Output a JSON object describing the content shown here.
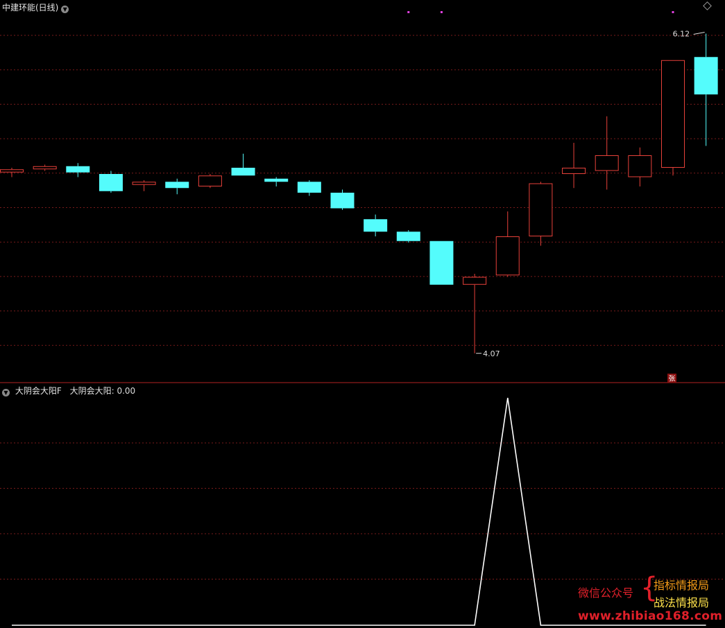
{
  "window": {
    "title": "中建环能(日线)",
    "header_icon": "chevron-down-icon",
    "menu_icon": "diamond-icon"
  },
  "colors": {
    "background": "#000000",
    "up": "#e8413a",
    "down": "#54fcfc",
    "grid": "#7a1b1b",
    "divider": "#b22222",
    "indicator_line": "#ffffff",
    "marker": "#e040e0"
  },
  "chart_data": [
    {
      "type": "candlestick",
      "title": "中建环能(日线)",
      "ylim": [
        3.98,
        6.22
      ],
      "grid": true,
      "high_label": "6.12",
      "low_label": "4.07",
      "badge": "张",
      "candles": [
        {
          "o": 5.23,
          "h": 5.26,
          "l": 5.2,
          "c": 5.25
        },
        {
          "o": 5.25,
          "h": 5.28,
          "l": 5.24,
          "c": 5.27
        },
        {
          "o": 5.27,
          "h": 5.29,
          "l": 5.2,
          "c": 5.23
        },
        {
          "o": 5.22,
          "h": 5.24,
          "l": 5.1,
          "c": 5.11
        },
        {
          "o": 5.15,
          "h": 5.18,
          "l": 5.11,
          "c": 5.17
        },
        {
          "o": 5.17,
          "h": 5.19,
          "l": 5.09,
          "c": 5.13
        },
        {
          "o": 5.14,
          "h": 5.22,
          "l": 5.13,
          "c": 5.21
        },
        {
          "o": 5.26,
          "h": 5.35,
          "l": 5.21,
          "c": 5.21
        },
        {
          "o": 5.19,
          "h": 5.2,
          "l": 5.14,
          "c": 5.17
        },
        {
          "o": 5.17,
          "h": 5.18,
          "l": 5.08,
          "c": 5.1
        },
        {
          "o": 5.1,
          "h": 5.12,
          "l": 4.99,
          "c": 5.0
        },
        {
          "o": 4.93,
          "h": 4.96,
          "l": 4.82,
          "c": 4.85
        },
        {
          "o": 4.85,
          "h": 4.86,
          "l": 4.78,
          "c": 4.79
        },
        {
          "o": 4.79,
          "h": 4.79,
          "l": 4.51,
          "c": 4.51
        },
        {
          "o": 4.51,
          "h": 4.58,
          "l": 4.07,
          "c": 4.56
        },
        {
          "o": 4.57,
          "h": 4.98,
          "l": 4.56,
          "c": 4.82
        },
        {
          "o": 4.82,
          "h": 5.17,
          "l": 4.76,
          "c": 5.16
        },
        {
          "o": 5.22,
          "h": 5.42,
          "l": 5.13,
          "c": 5.26
        },
        {
          "o": 5.24,
          "h": 5.59,
          "l": 5.12,
          "c": 5.34
        },
        {
          "o": 5.2,
          "h": 5.39,
          "l": 5.14,
          "c": 5.34
        },
        {
          "o": 5.26,
          "h": 5.95,
          "l": 5.21,
          "c": 5.95
        },
        {
          "o": 5.97,
          "h": 6.12,
          "l": 5.4,
          "c": 5.73
        }
      ],
      "markers": [
        12,
        13,
        20
      ]
    },
    {
      "type": "line",
      "title": "大阴会大阳F",
      "series": [
        {
          "name": "大阴会大阳",
          "value_label": "0.00",
          "values": [
            0,
            0,
            0,
            0,
            0,
            0,
            0,
            0,
            0,
            0,
            0,
            0,
            0,
            0,
            0,
            1,
            0,
            0,
            0,
            0,
            0,
            0
          ]
        }
      ],
      "ylim": [
        0,
        1
      ],
      "grid": true
    }
  ],
  "watermark": {
    "wechat": "微信公众号",
    "line1": "指标情报局",
    "line2": "战法情报局",
    "url": "www.zhibiao168.com"
  }
}
